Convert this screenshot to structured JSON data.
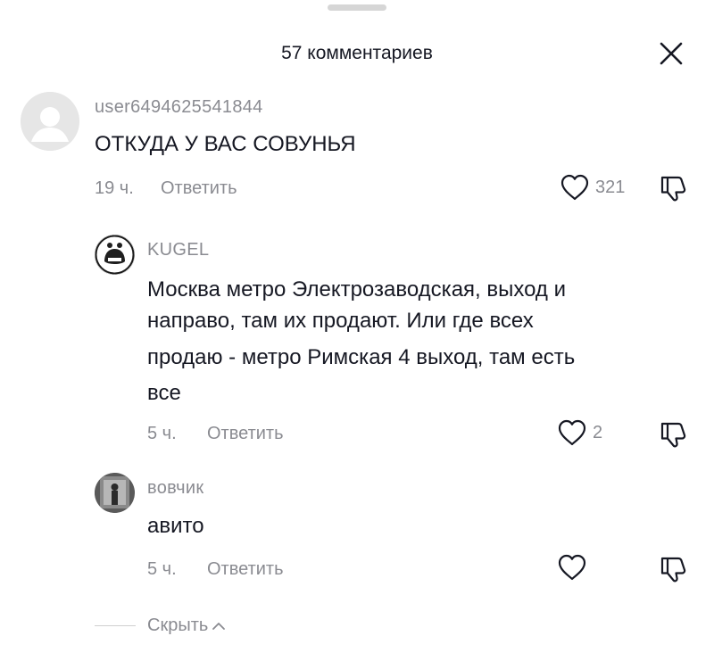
{
  "header": {
    "title": "57 комментариев"
  },
  "icons": {
    "close": "close-icon",
    "like": "heart-outline-icon",
    "dislike": "thumbs-down-icon",
    "chevron": "chevron-up-icon",
    "default_avatar": "default-avatar-icon"
  },
  "comments": [
    {
      "username": "user6494625541844",
      "text": "ОТКУДА У ВАС СОВУНЬЯ",
      "time": "19 ч.",
      "reply_label": "Ответить",
      "likes": "321"
    }
  ],
  "replies": [
    {
      "username": "KUGEL",
      "text_lines": [
        "Москва метро Электрозаводская, выход и",
        "направо, там их продают. Или где всех",
        "продаю - метро Римская 4 выход, там есть",
        "все"
      ],
      "time": "5 ч.",
      "reply_label": "Ответить",
      "likes": "2"
    },
    {
      "username": "вовчик",
      "text_lines": [
        "авито"
      ],
      "time": "5 ч.",
      "reply_label": "Ответить",
      "likes": ""
    }
  ],
  "footer": {
    "hide_label": "Скрыть"
  }
}
